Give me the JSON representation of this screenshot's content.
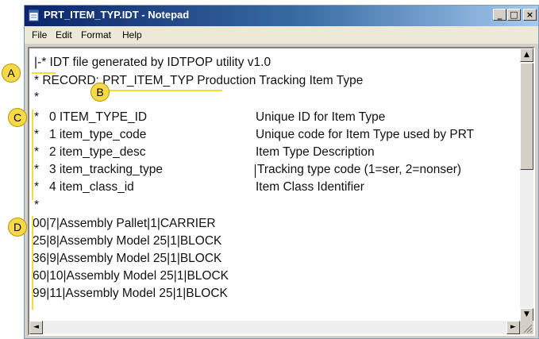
{
  "window": {
    "title": "PRT_ITEM_TYP.IDT - Notepad",
    "controls": {
      "minimize": "_",
      "maximize": "□",
      "close": "×"
    }
  },
  "menu": [
    "File",
    "Edit",
    "Format",
    "Help"
  ],
  "editor": {
    "header_lines": [
      "|-* IDT file generated by IDTPOP utility v1.0",
      "* RECORD: PRT_ITEM_TYP Production Tracking Item Type",
      "*"
    ],
    "fields": [
      {
        "prefix": "*   0 ITEM_TYPE_ID",
        "desc": "Unique ID for Item Type"
      },
      {
        "prefix": "*   1 item_type_code",
        "desc": "Unique code for Item Type used by PRT"
      },
      {
        "prefix": "*   2 item_type_desc",
        "desc": "Item Type Description"
      },
      {
        "prefix": "*   3 item_tracking_type",
        "desc": "Tracking type code (1=ser, 2=nonser)"
      },
      {
        "prefix": "*   4 item_class_id",
        "desc": "Item Class Identifier"
      }
    ],
    "separator": "*",
    "data_rows": [
      "00|7|Assembly Pallet|1|CARRIER",
      "25|8|Assembly Model 25|1|BLOCK",
      "36|9|Assembly Model 25|1|BLOCK",
      "60|10|Assembly Model 25|1|BLOCK",
      "99|11|Assembly Model 25|1|BLOCK"
    ]
  },
  "callouts": {
    "a": "A",
    "b": "B",
    "c": "C",
    "d": "D"
  },
  "scroll": {
    "up": "▲",
    "down": "▼",
    "left": "◄",
    "right": "►"
  },
  "colors": {
    "callout": "#f5d94a",
    "titlebar": "#0a246a"
  }
}
